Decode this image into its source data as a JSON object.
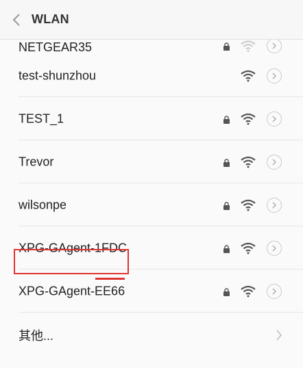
{
  "header": {
    "title": "WLAN"
  },
  "networks": [
    {
      "ssid": "NETGEAR35",
      "locked": true,
      "signal": "weak"
    },
    {
      "ssid": "test-shunzhou",
      "locked": false,
      "signal": "strong"
    },
    {
      "ssid": "TEST_1",
      "locked": true,
      "signal": "strong"
    },
    {
      "ssid": "Trevor",
      "locked": true,
      "signal": "strong"
    },
    {
      "ssid": "wilsonpe",
      "locked": true,
      "signal": "strong"
    },
    {
      "ssid": "XPG-GAgent-1FDC",
      "locked": true,
      "signal": "strong",
      "highlighted": true
    },
    {
      "ssid": "XPG-GAgent-EE66",
      "locked": true,
      "signal": "strong"
    }
  ],
  "more": {
    "label": "其他..."
  },
  "colors": {
    "highlight": "#e03131",
    "icon": "#555555",
    "icon_faded": "#cccccc"
  }
}
